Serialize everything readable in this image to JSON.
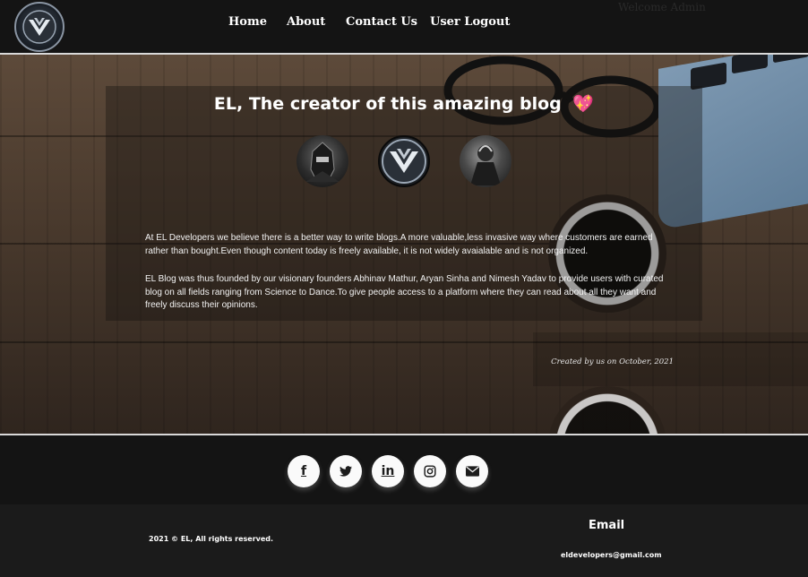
{
  "header": {
    "logo_icon": "shield-eagle-logo-icon",
    "welcome_text": "Welcome Admin",
    "nav": [
      {
        "label": "Home"
      },
      {
        "label": "About"
      },
      {
        "label": "Contact Us"
      },
      {
        "label": "User Logout"
      }
    ]
  },
  "hero": {
    "title": "EL, The creator of this amazing blog",
    "title_emoji": "💖",
    "avatars": [
      "founder-avatar-icon",
      "shield-eagle-avatar-icon",
      "founder-avatar-icon"
    ],
    "paragraphs": [
      "At EL Developers we believe there is a better way to write blogs.A more valuable,less invasive way where customers are earned rather than bought.Even though content today is freely available, it is not widely avaialable and is not organized.",
      "EL Blog was thus founded by our visionary founders Abhinav Mathur, Aryan Sinha and Nimesh Yadav to provide users with curated blog on all fields ranging from Science to Dance.To give people access to a platform where they can read about all they want and freely discuss their opinions."
    ],
    "credit": "Created by us on October, 2021"
  },
  "social": {
    "buttons": [
      {
        "icon": "facebook-icon",
        "glyph": "f"
      },
      {
        "icon": "twitter-icon",
        "glyph": "🐦"
      },
      {
        "icon": "linkedin-icon",
        "glyph": "in"
      },
      {
        "icon": "instagram-icon",
        "glyph": "◎"
      },
      {
        "icon": "envelope-icon",
        "glyph": "✉"
      }
    ]
  },
  "footer": {
    "copyright": "2021 © EL, All rights reserved.",
    "email_heading": "Email",
    "email_address": "eldevelopers@gmail.com"
  },
  "colors": {
    "background": "#141414",
    "footer_bg": "#1b1b1b",
    "divider": "#d9d9d9",
    "heart": "#e0405e"
  }
}
